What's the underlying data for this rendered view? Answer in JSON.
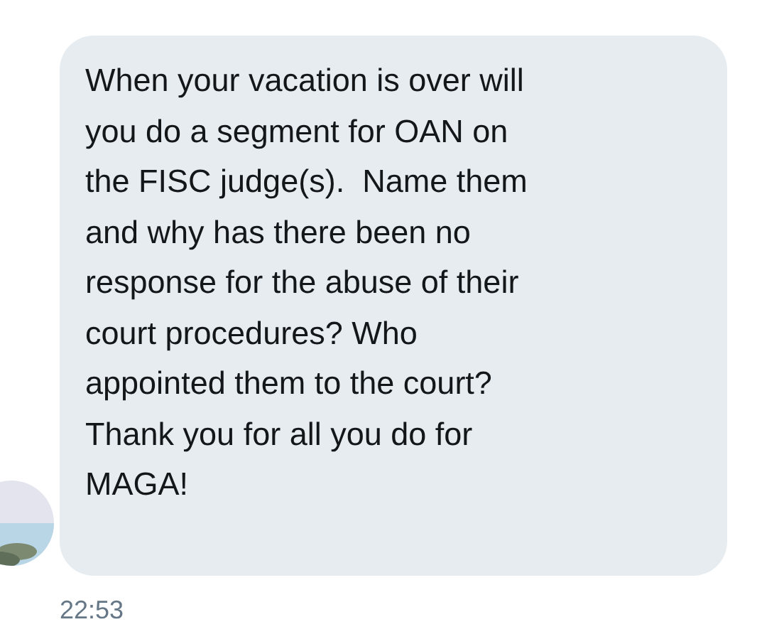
{
  "message": {
    "text": "When your vacation is over will\nyou do a segment for OAN on\nthe FISC judge(s).  Name them\nand why has there been no\nresponse for the abuse of their\ncourt procedures? Who\nappointed them to the court?\nThank you for all you do for\nMAGA!",
    "time": "22:53"
  }
}
